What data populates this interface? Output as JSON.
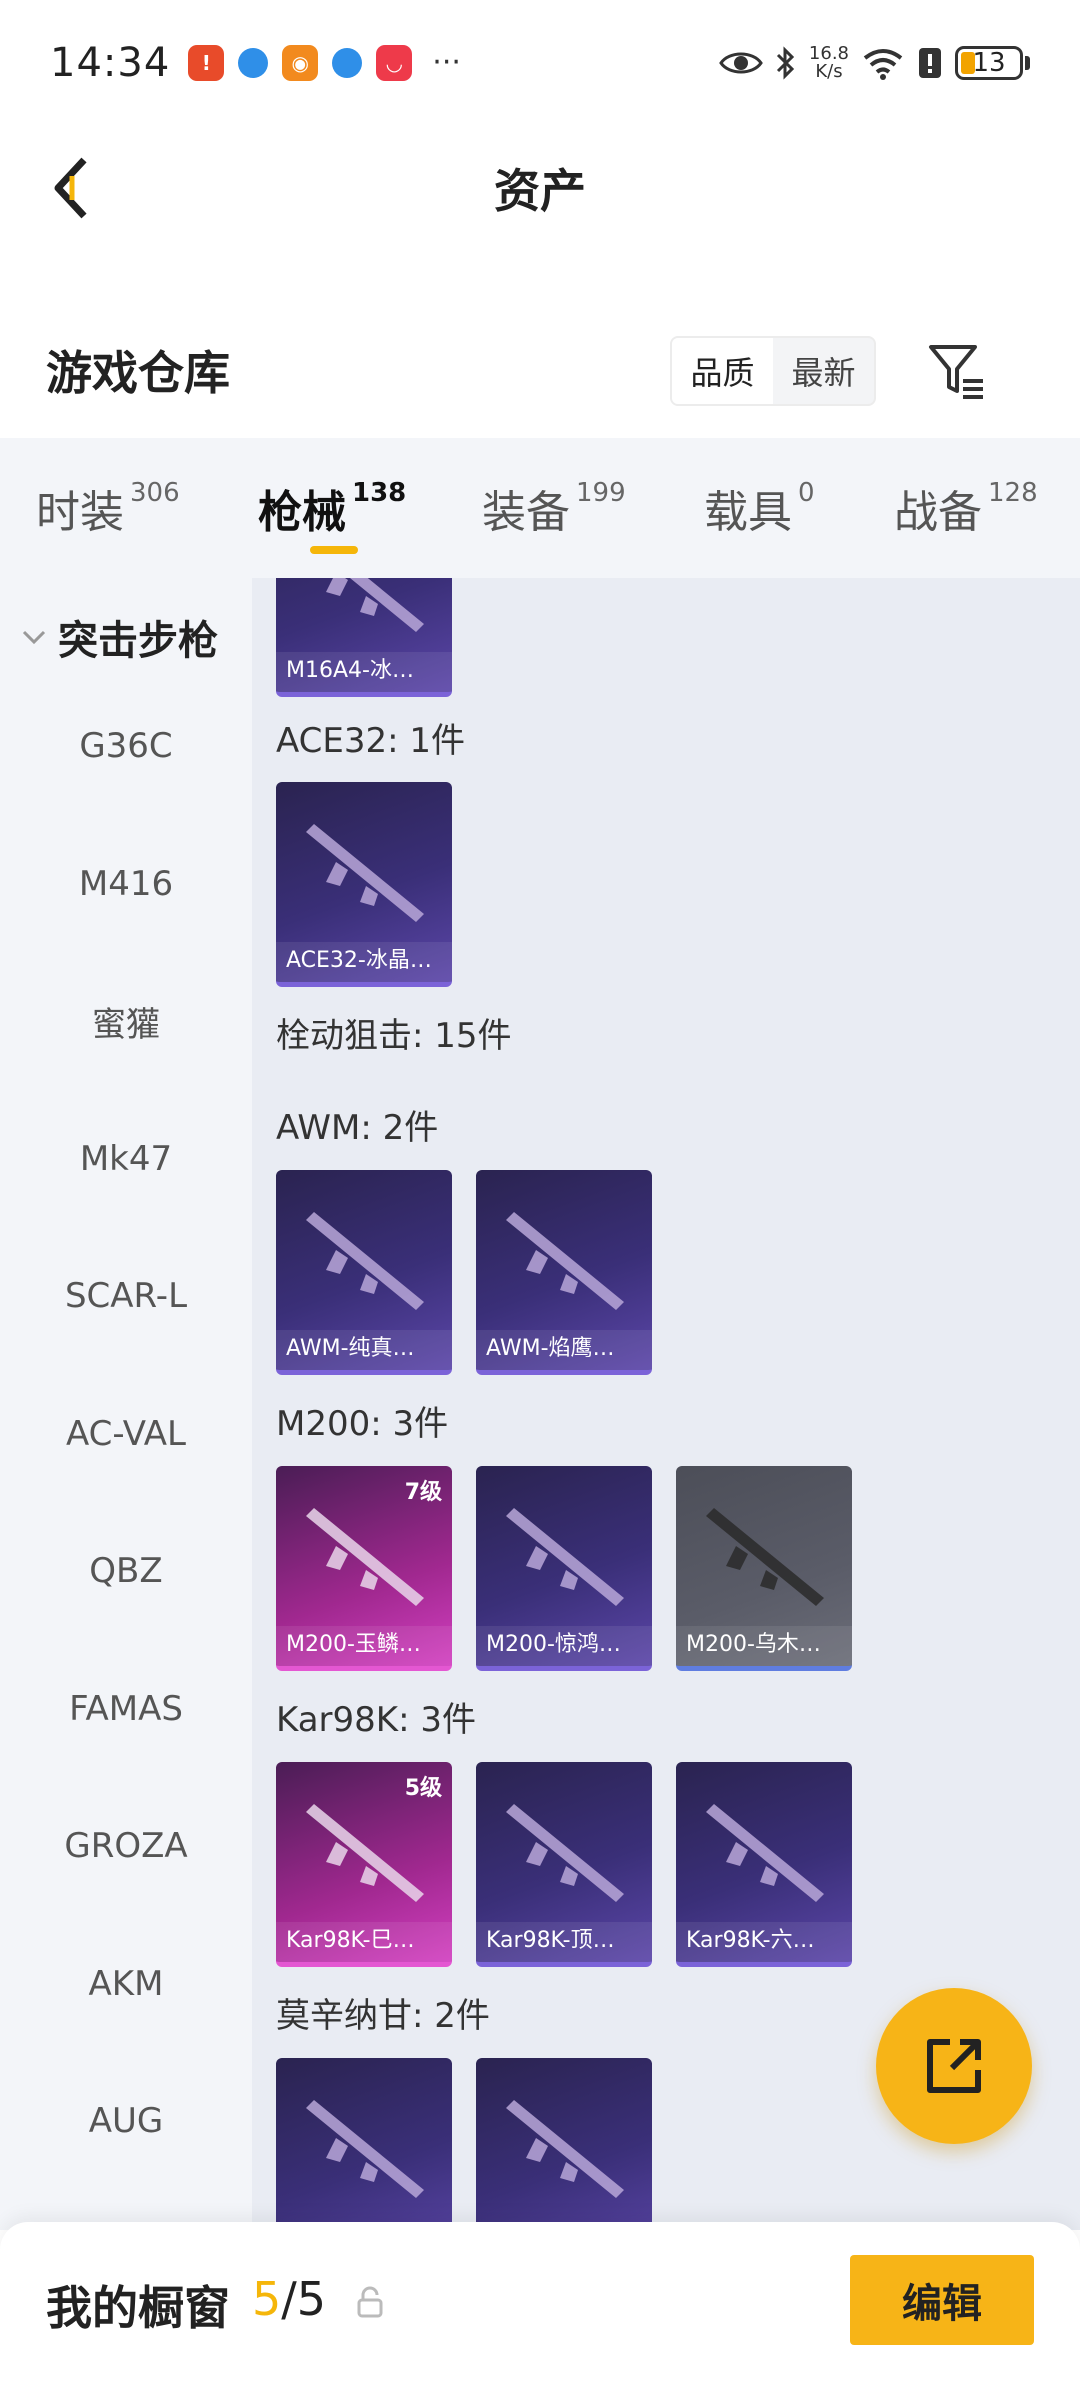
{
  "status_bar": {
    "time": "14:34",
    "more": "···",
    "speed_value": "16.8",
    "speed_unit": "K/s",
    "battery": "13"
  },
  "header": {
    "title": "资产"
  },
  "section": {
    "title": "游戏仓库",
    "sort_options": [
      "品质",
      "最新"
    ],
    "sort_active": "品质"
  },
  "tabs": [
    {
      "label": "时装",
      "count": "306"
    },
    {
      "label": "枪械",
      "count": "138",
      "active": true
    },
    {
      "label": "装备",
      "count": "199"
    },
    {
      "label": "载具",
      "count": "0"
    },
    {
      "label": "战备",
      "count": "128"
    }
  ],
  "categories": {
    "header": "突击步枪",
    "items": [
      "G36C",
      "M416",
      "蜜獾",
      "Mk47",
      "SCAR-L",
      "AC-VAL",
      "QBZ",
      "FAMAS",
      "GROZA",
      "AKM",
      "AUG"
    ]
  },
  "groups": [
    {
      "label": "",
      "items": [
        {
          "name": "M16A4-冰…",
          "style": "purple"
        }
      ]
    },
    {
      "label": "ACE32: 1件",
      "items": [
        {
          "name": "ACE32-冰晶…",
          "style": "purple"
        }
      ]
    },
    {
      "label": "栓动狙击: 15件",
      "items": []
    },
    {
      "label": "AWM: 2件",
      "items": [
        {
          "name": "AWM-纯真…",
          "style": "purple"
        },
        {
          "name": "AWM-焰鹰…",
          "style": "purple"
        }
      ]
    },
    {
      "label": "M200: 3件",
      "items": [
        {
          "name": "M200-玉鳞…",
          "style": "pink",
          "level": "7级"
        },
        {
          "name": "M200-惊鸿…",
          "style": "purple"
        },
        {
          "name": "M200-乌木…",
          "style": "gray"
        }
      ]
    },
    {
      "label": "Kar98K: 3件",
      "items": [
        {
          "name": "Kar98K-巳…",
          "style": "pink",
          "level": "5级"
        },
        {
          "name": "Kar98K-顶…",
          "style": "purple"
        },
        {
          "name": "Kar98K-六…",
          "style": "purple"
        }
      ]
    },
    {
      "label": "莫辛纳甘: 2件",
      "items": [
        {
          "name": "",
          "style": "purple"
        },
        {
          "name": "",
          "style": "purple"
        }
      ]
    }
  ],
  "bottom_bar": {
    "title": "我的橱窗",
    "count_current": "5",
    "count_total": "/5",
    "edit_label": "编辑"
  },
  "colors": {
    "accent": "#f7b417",
    "tab_bg": "#f3f5f9",
    "content_bg": "#e9ecf3"
  },
  "icons": [
    "back-arrow-icon",
    "filter-icon",
    "chevron-down-icon",
    "share-external-icon",
    "lock-icon",
    "eye-icon",
    "bluetooth-icon",
    "wifi-icon"
  ]
}
